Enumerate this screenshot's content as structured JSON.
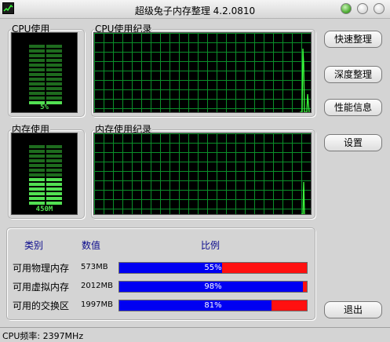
{
  "title": "超级兔子内存整理 4.2.0810",
  "cpu_panel": {
    "label": "CPU使用",
    "value": "5%",
    "level": 0.05
  },
  "cpu_history": {
    "label": "CPU使用纪录"
  },
  "mem_panel": {
    "label": "内存使用",
    "value": "450M",
    "level": 0.44
  },
  "mem_history": {
    "label": "内存使用纪录"
  },
  "buttons": {
    "quick": "快速整理",
    "deep": "深度整理",
    "perf": "性能信息",
    "settings": "设置",
    "exit": "退出"
  },
  "table": {
    "headers": {
      "category": "类别",
      "value": "数值",
      "ratio": "比例"
    },
    "rows": [
      {
        "label": "可用物理内存",
        "value": "573MB",
        "percent": "55%",
        "fraction": 0.55
      },
      {
        "label": "可用虚拟内存",
        "value": "2012MB",
        "percent": "98%",
        "fraction": 0.98
      },
      {
        "label": "可用的交换区",
        "value": "1997MB",
        "percent": "81%",
        "fraction": 0.81
      }
    ]
  },
  "status": {
    "text": "CPU频率: 2397MHz"
  },
  "colors": {
    "meter_dim": "#1e6b1e",
    "meter_lit": "#52e052",
    "grid": "#0b8f2a",
    "trace": "#3cff3c",
    "bar_used": "#0000f2",
    "bar_free": "#ff1010",
    "header_text": "#0a0a8c"
  }
}
